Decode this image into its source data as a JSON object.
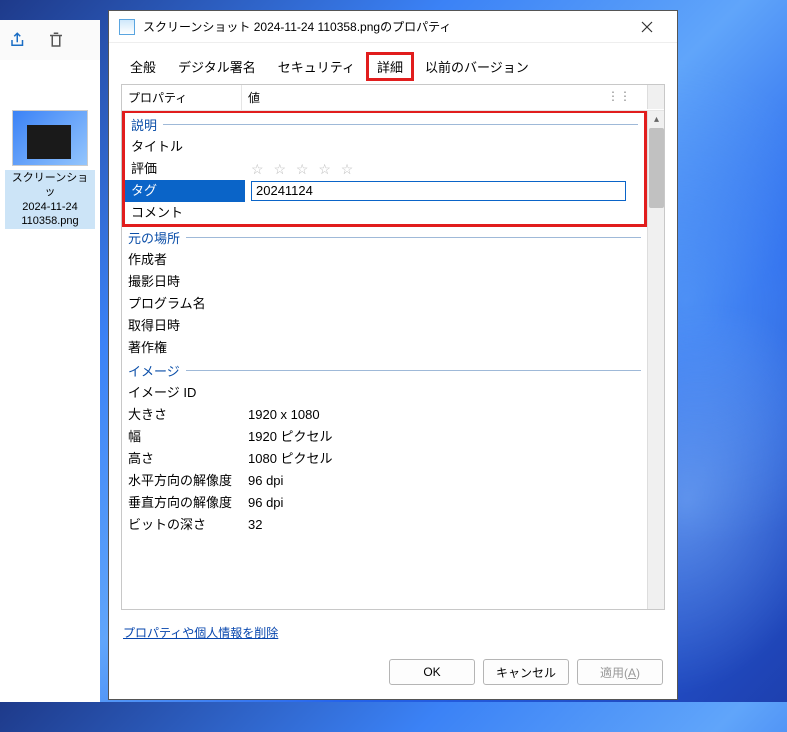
{
  "explorer": {
    "file": {
      "name_line1": "スクリーンショッ",
      "name_line2": "2024-11-24",
      "name_line3": "110358.png"
    }
  },
  "dialog": {
    "title": "スクリーンショット 2024-11-24 110358.pngのプロパティ",
    "tabs": {
      "general": "全般",
      "signature": "デジタル署名",
      "security": "セキュリティ",
      "details": "詳細",
      "versions": "以前のバージョン"
    },
    "headers": {
      "property": "プロパティ",
      "value": "値"
    },
    "sections": {
      "description": "説明",
      "origin": "元の場所",
      "image": "イメージ"
    },
    "props": {
      "title": "タイトル",
      "rating": "評価",
      "tag": "タグ",
      "comment": "コメント",
      "author": "作成者",
      "date_taken": "撮影日時",
      "program": "プログラム名",
      "acquired": "取得日時",
      "copyright": "著作権",
      "image_id": "イメージ ID",
      "dimensions": "大きさ",
      "width": "幅",
      "height": "高さ",
      "hres": "水平方向の解像度",
      "vres": "垂直方向の解像度",
      "bitdepth": "ビットの深さ"
    },
    "values": {
      "tag_input": "20241124",
      "stars": "☆ ☆ ☆ ☆ ☆",
      "dimensions": "1920 x 1080",
      "width": "1920 ピクセル",
      "height": "1080 ピクセル",
      "hres": "96 dpi",
      "vres": "96 dpi",
      "bitdepth": "32"
    },
    "remove_link": "プロパティや個人情報を削除",
    "buttons": {
      "ok": "OK",
      "cancel": "キャンセル",
      "apply": "適用",
      "apply_mnemonic": "A"
    }
  }
}
